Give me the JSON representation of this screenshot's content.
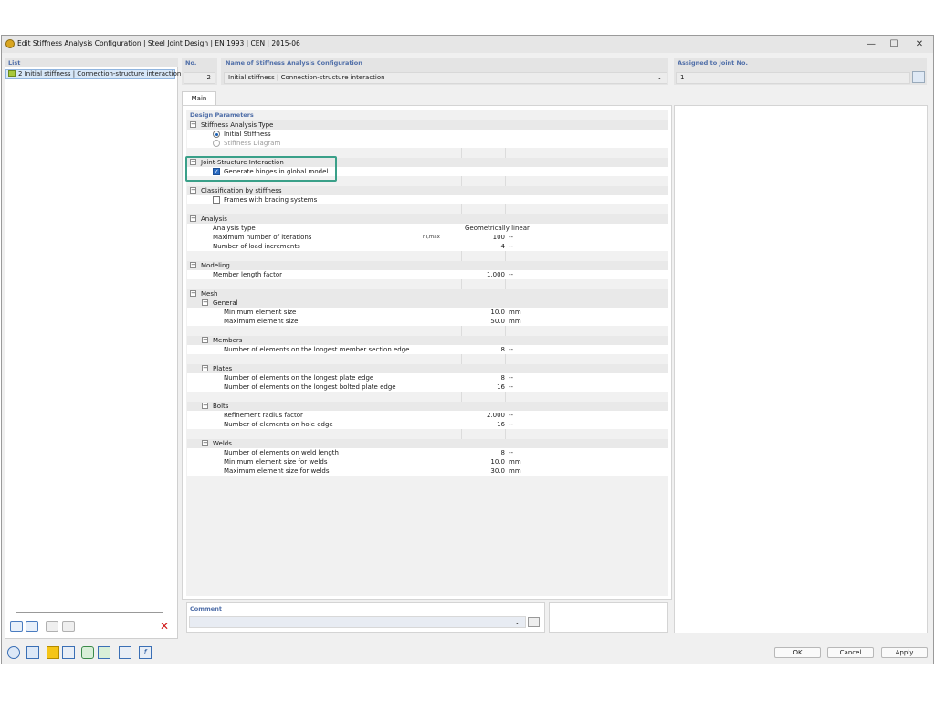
{
  "window": {
    "title": "Edit Stiffness Analysis Configuration | Steel Joint Design | EN 1993 | CEN | 2015-06",
    "min_glyph": "—",
    "max_glyph": "☐",
    "close_glyph": "✕"
  },
  "list": {
    "header": "List",
    "item_number": "2",
    "item_label": "Initial stiffness | Connection-structure interaction"
  },
  "no": {
    "header": "No.",
    "value": "2"
  },
  "name": {
    "header": "Name of Stiffness Analysis Configuration",
    "value": "Initial stiffness | Connection-structure interaction"
  },
  "assigned": {
    "header": "Assigned to Joint No.",
    "value": "1"
  },
  "tab": {
    "main": "Main"
  },
  "design": {
    "header": "Design Parameters"
  },
  "tree": {
    "stiff_type": "Stiffness Analysis Type",
    "initial": "Initial Stiffness",
    "diagram": "Stiffness Diagram",
    "jsi": "Joint-Structure Interaction",
    "hinges": "Generate hinges in global model",
    "class": "Classification by stiffness",
    "frames": "Frames with bracing systems",
    "analysis": "Analysis",
    "atype": "Analysis type",
    "atype_val": "Geometrically linear",
    "maxit": "Maximum number of iterations",
    "maxit_sym": "nI,max",
    "maxit_val": "100",
    "nload": "Number of load increments",
    "nload_val": "4",
    "modeling": "Modeling",
    "mlf": "Member length factor",
    "mlf_val": "1.000",
    "mesh": "Mesh",
    "general": "General",
    "minel": "Minimum element size",
    "minel_val": "10.0",
    "maxel": "Maximum element size",
    "maxel_val": "50.0",
    "members": "Members",
    "nmem": "Number of elements on the longest member section edge",
    "nmem_val": "8",
    "plates": "Plates",
    "npl": "Number of elements on the longest plate edge",
    "npl_val": "8",
    "nbpl": "Number of elements on the longest bolted plate edge",
    "nbpl_val": "16",
    "bolts": "Bolts",
    "rrf": "Refinement radius factor",
    "rrf_val": "2.000",
    "nhole": "Number of elements on hole edge",
    "nhole_val": "16",
    "welds": "Welds",
    "nweld": "Number of elements on weld length",
    "nweld_val": "8",
    "minw": "Minimum element size for welds",
    "minw_val": "10.0",
    "maxw": "Maximum element size for welds",
    "maxw_val": "30.0",
    "unit_mm": "mm",
    "unit_dash": "--"
  },
  "comment": {
    "header": "Comment"
  },
  "buttons": {
    "ok": "OK",
    "cancel": "Cancel",
    "apply": "Apply"
  },
  "colors": {
    "accent": "#4f6ea8",
    "highlight": "#3aa089",
    "selection": "#d7e7f8"
  }
}
